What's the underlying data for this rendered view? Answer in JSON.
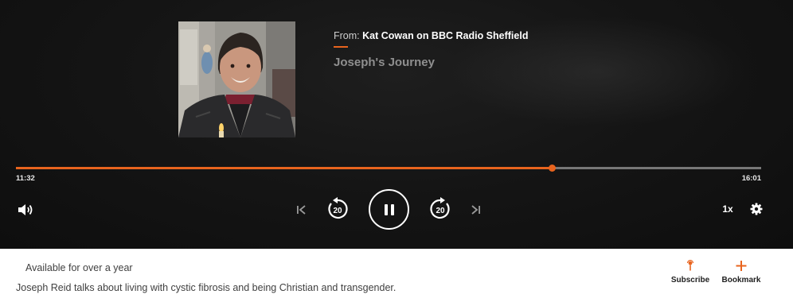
{
  "episode": {
    "from_prefix": "From:",
    "station": "Kat Cowan on BBC Radio Sheffield",
    "title": "Joseph's Journey",
    "artwork_icon": "host-portrait-image"
  },
  "progress": {
    "elapsed": "11:32",
    "total": "16:01",
    "fraction": 0.72
  },
  "controls": {
    "volume_icon": "speaker-icon",
    "previous_icon": "skip-previous-icon",
    "rewind_label": "20",
    "play_state_icon": "pause-icon",
    "forward_label": "20",
    "next_icon": "skip-next-icon",
    "speed": "1x",
    "settings_icon": "gear-icon"
  },
  "info": {
    "availability": "Available for over a year",
    "description": "Joseph Reid talks about living with cystic fibrosis and being Christian and transgender.",
    "subscribe_label": "Subscribe",
    "bookmark_label": "Bookmark"
  },
  "colors": {
    "accent": "#e8641e",
    "player_background": "#141414",
    "track": "#777777"
  }
}
